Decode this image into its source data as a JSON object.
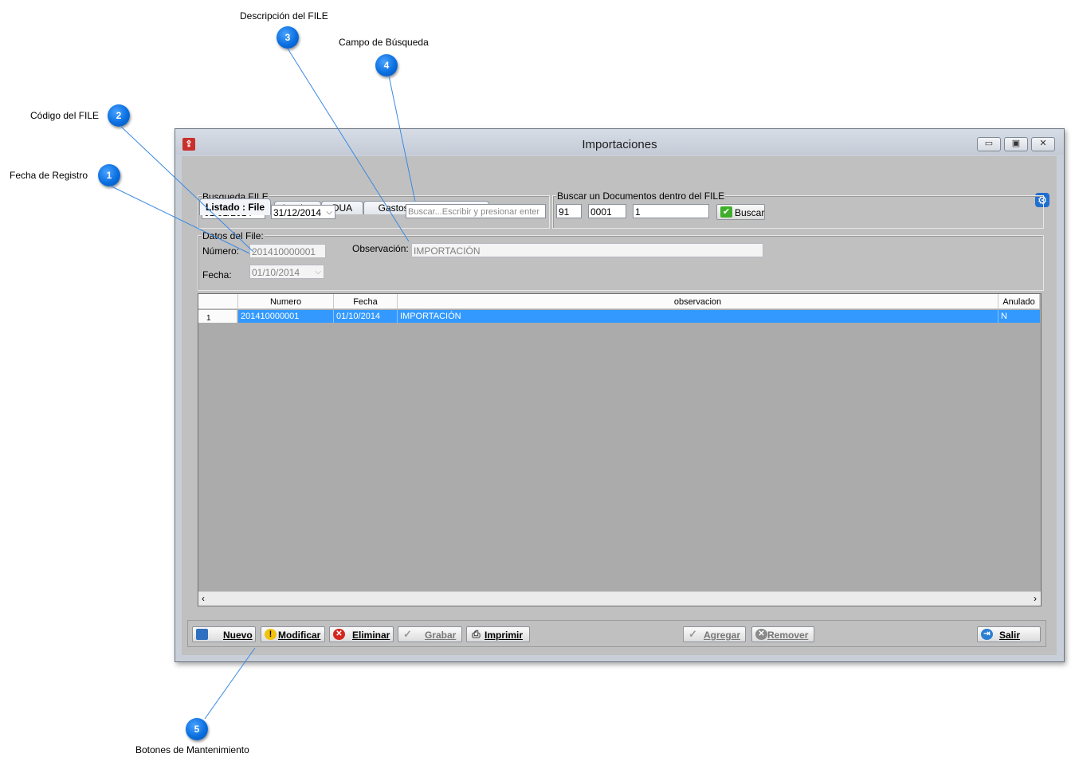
{
  "callouts": [
    {
      "num": "1",
      "label": "Fecha de Registro"
    },
    {
      "num": "2",
      "label": "Código del FILE"
    },
    {
      "num": "3",
      "label": "Descripción del FILE"
    },
    {
      "num": "4",
      "label": "Campo de Búsqueda"
    },
    {
      "num": "5",
      "label": "Botones de Mantenimiento"
    }
  ],
  "window": {
    "title": "Importaciones",
    "controls": {
      "minimize": "▭",
      "maximize": "▣",
      "close": "✕"
    }
  },
  "tabs": [
    {
      "label": "Listado : File",
      "active": true
    },
    {
      "label": "Invoice",
      "active": false
    },
    {
      "label": "DUA",
      "active": false
    },
    {
      "label": "Gastos de Importación",
      "active": false
    }
  ],
  "busqueda": {
    "legend": "Busqueda FILE",
    "date_from": "01/01/2014",
    "date_to": "31/12/2014",
    "search_placeholder": "Buscar...Escribir y presionar enter"
  },
  "buscar_doc": {
    "legend": "Buscar un  Documentos dentro del FILE",
    "field1": "91",
    "field2": "0001",
    "field3": "1",
    "button": "Buscar"
  },
  "datos": {
    "legend": "Datos del File:",
    "numero_label": "Número:",
    "numero_value": "201410000001",
    "fecha_label": "Fecha:",
    "fecha_value": "01/10/2014",
    "observacion_label": "Observación:",
    "observacion_value": "IMPORTACIÓN"
  },
  "grid": {
    "columns": [
      "Numero",
      "Fecha",
      "observacion",
      "Anulado"
    ],
    "rows": [
      {
        "row_num": "1",
        "numero": "201410000001",
        "fecha": "01/10/2014",
        "observacion": "IMPORTACIÓN",
        "anulado": "N"
      }
    ]
  },
  "toolbar": {
    "nuevo": "Nuevo",
    "modificar": "Modificar",
    "eliminar": "Eliminar",
    "grabar": "Grabar",
    "imprimir": "Imprimir",
    "agregar": "Agregar",
    "remover": "Remover",
    "salir": "Salir"
  },
  "colors": {
    "callout_bubble": "#0a6fe0",
    "selection": "#3399ff",
    "window_bg": "#c0c0c0"
  }
}
